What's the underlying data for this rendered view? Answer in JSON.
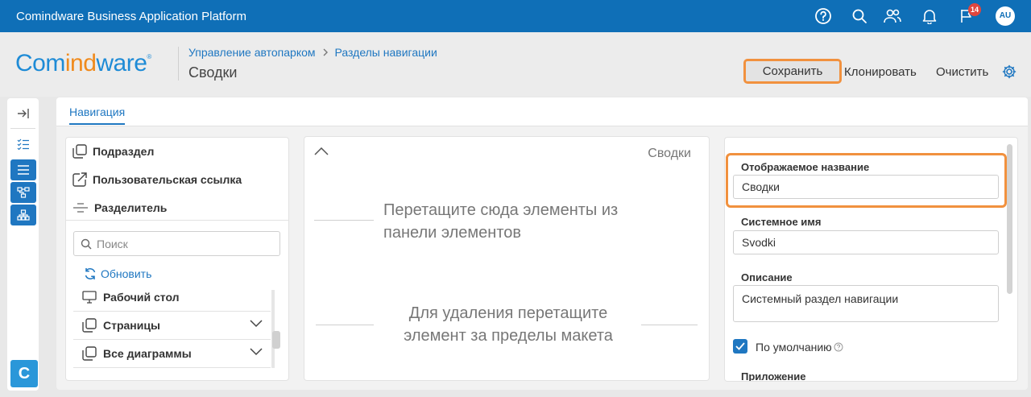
{
  "topbar": {
    "app_title": "Comindware Business Application Platform",
    "notifications_badge": "14",
    "avatar_initials": "AU",
    "icons": [
      "help-icon",
      "search-icon",
      "users-icon",
      "bell-icon",
      "flag-icon"
    ]
  },
  "header": {
    "logo": {
      "part1": "Com",
      "part2": "ind",
      "part3": "ware",
      "mark": "®"
    },
    "breadcrumb": [
      "Управление автопарком",
      "Разделы навигации"
    ],
    "title": "Сводки",
    "buttons": {
      "save": "Сохранить",
      "clone": "Клонировать",
      "clear": "Очистить"
    }
  },
  "tabs": {
    "navigation": "Навигация"
  },
  "elements_panel": {
    "items": [
      "Подраздел",
      "Пользовательская ссылка",
      "Разделитель"
    ],
    "search_placeholder": "Поиск",
    "refresh_label": "Обновить",
    "tree": [
      "Рабочий стол",
      "Страницы",
      "Все диаграммы"
    ]
  },
  "canvas": {
    "title": "Сводки",
    "hint_drop_1": "Перетащите сюда элементы из",
    "hint_drop_2": "панели элементов",
    "hint_remove_1": "Для удаления перетащите",
    "hint_remove_2": "элемент за пределы макета"
  },
  "properties": {
    "display_name_label": "Отображаемое название",
    "display_name_value": "Сводки",
    "system_name_label": "Системное имя",
    "system_name_value": "Svodki",
    "description_label": "Описание",
    "description_value": "Системный раздел навигации",
    "default_label": "По умолчанию",
    "app_label": "Приложение"
  },
  "colors": {
    "accent": "#1f77c1",
    "topbar": "#0f6fb7",
    "highlight": "#f1913e",
    "logo_blue": "#1e8bd6",
    "logo_orange": "#f08a1c"
  }
}
